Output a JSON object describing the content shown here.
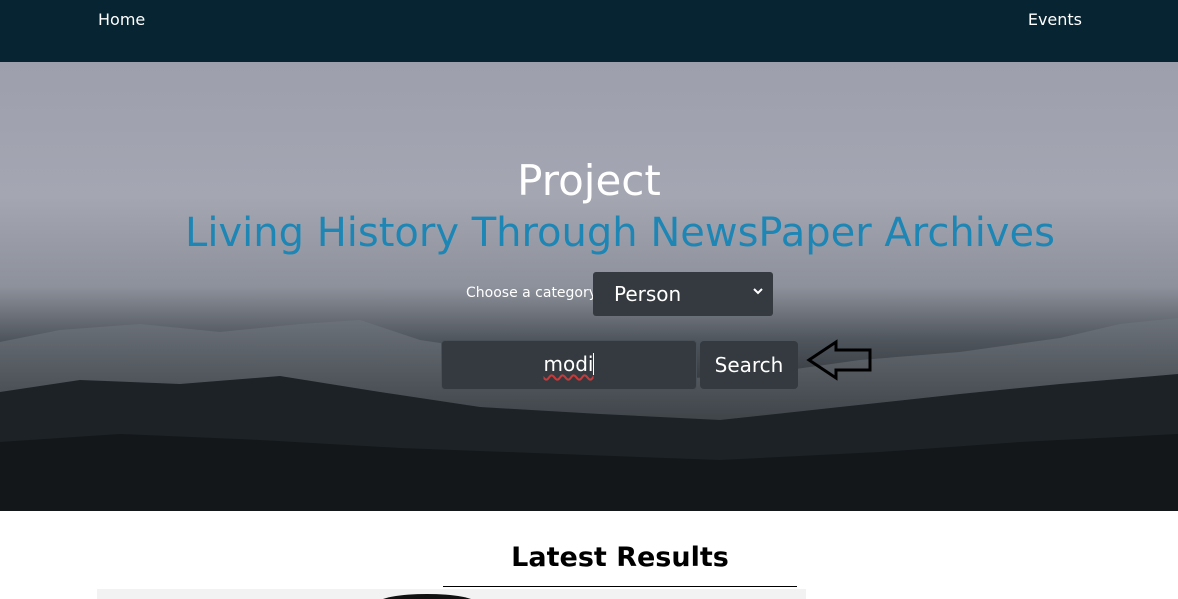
{
  "nav": {
    "home_label": "Home",
    "events_label": "Events"
  },
  "hero": {
    "title": "Project",
    "subtitle": "Living History Through NewsPaper Archives",
    "category_label": "Choose a category:",
    "category_selected": "Person",
    "search_value": "modi",
    "search_button_label": "Search"
  },
  "results": {
    "heading": "Latest Results"
  },
  "icons": {
    "select_icon": "chevron-down-icon",
    "annotation_icon": "arrow-left-icon"
  },
  "colors": {
    "nav_background": "#062431",
    "subtitle": "#1d86b5",
    "control_background": "#343a40"
  }
}
